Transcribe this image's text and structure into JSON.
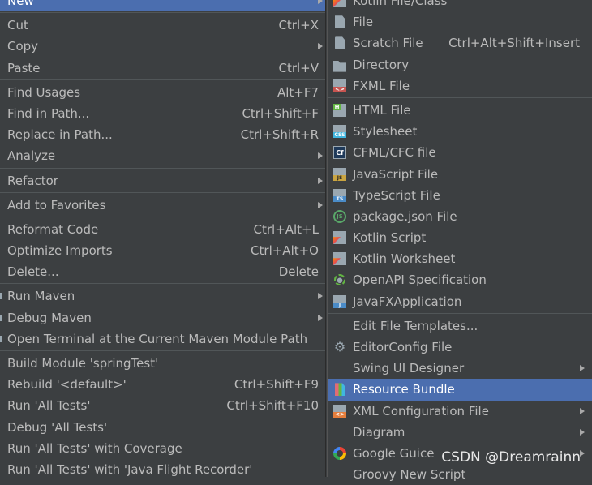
{
  "left_menu": {
    "groups": [
      [
        {
          "label": "New",
          "shortcut": "",
          "submenu": true,
          "selected": true
        }
      ],
      [
        {
          "label": "Cut",
          "shortcut": "Ctrl+X"
        },
        {
          "label": "Copy",
          "shortcut": "",
          "submenu": true
        },
        {
          "label": "Paste",
          "shortcut": "Ctrl+V"
        }
      ],
      [
        {
          "label": "Find Usages",
          "shortcut": "Alt+F7"
        },
        {
          "label": "Find in Path...",
          "shortcut": "Ctrl+Shift+F"
        },
        {
          "label": "Replace in Path...",
          "shortcut": "Ctrl+Shift+R"
        },
        {
          "label": "Analyze",
          "shortcut": "",
          "submenu": true
        }
      ],
      [
        {
          "label": "Refactor",
          "shortcut": "",
          "submenu": true
        }
      ],
      [
        {
          "label": "Add to Favorites",
          "shortcut": "",
          "submenu": true
        }
      ],
      [
        {
          "label": "Reformat Code",
          "shortcut": "Ctrl+Alt+L"
        },
        {
          "label": "Optimize Imports",
          "shortcut": "Ctrl+Alt+O"
        },
        {
          "label": "Delete...",
          "shortcut": "Delete"
        }
      ],
      [
        {
          "label": "Run Maven",
          "shortcut": "",
          "submenu": true,
          "maven": true
        },
        {
          "label": "Debug Maven",
          "shortcut": "",
          "submenu": true,
          "maven": true
        },
        {
          "label": "Open Terminal at the Current Maven Module Path",
          "shortcut": "",
          "maven": true
        }
      ],
      [
        {
          "label": "Build Module 'springTest'",
          "shortcut": ""
        },
        {
          "label": "Rebuild '<default>'",
          "shortcut": "Ctrl+Shift+F9"
        },
        {
          "label": "Run 'All Tests'",
          "shortcut": "Ctrl+Shift+F10"
        },
        {
          "label": "Debug 'All Tests'",
          "shortcut": ""
        },
        {
          "label": "Run 'All Tests' with Coverage",
          "shortcut": ""
        },
        {
          "label": "Run 'All Tests' with 'Java Flight Recorder'",
          "shortcut": ""
        }
      ]
    ]
  },
  "right_menu": {
    "groups": [
      [
        {
          "label": "Kotlin File/Class",
          "icon": "kotlin-file-icon",
          "cls": "ic-kotlin"
        },
        {
          "label": "File",
          "icon": "file-icon",
          "cls": "ic-file"
        },
        {
          "label": "Scratch File",
          "shortcut": "Ctrl+Alt+Shift+Insert",
          "icon": "scratch-file-icon",
          "cls": "ic-scratch"
        },
        {
          "label": "Directory",
          "icon": "folder-icon",
          "cls": "ic-folder"
        },
        {
          "label": "FXML File",
          "icon": "fxml-file-icon",
          "cls": "ic-fxml"
        }
      ],
      [
        {
          "label": "HTML File",
          "icon": "html-file-icon",
          "cls": "ic-html"
        },
        {
          "label": "Stylesheet",
          "icon": "css-file-icon",
          "cls": "ic-css",
          "text": ""
        },
        {
          "label": "CFML/CFC file",
          "icon": "cfml-file-icon",
          "cls": "ic-cf",
          "text": "Cf"
        },
        {
          "label": "JavaScript File",
          "icon": "javascript-file-icon",
          "cls": "ic-js"
        },
        {
          "label": "TypeScript File",
          "icon": "typescript-file-icon",
          "cls": "ic-ts"
        },
        {
          "label": "package.json File",
          "icon": "nodejs-icon",
          "cls": "ic-json",
          "text": "JS"
        },
        {
          "label": "Kotlin Script",
          "icon": "kotlin-script-icon",
          "cls": "ic-kotlin"
        },
        {
          "label": "Kotlin Worksheet",
          "icon": "kotlin-worksheet-icon",
          "cls": "ic-kotlin"
        },
        {
          "label": "OpenAPI Specification",
          "icon": "openapi-icon",
          "cls": "ic-openapi"
        },
        {
          "label": "JavaFXApplication",
          "icon": "javafx-icon",
          "cls": "ic-javafx"
        }
      ],
      [
        {
          "label": "Edit File Templates...",
          "icon": ""
        },
        {
          "label": "EditorConfig File",
          "icon": "gear-icon",
          "cls": "ic-gear",
          "text": "⚙"
        },
        {
          "label": "Swing UI Designer",
          "icon": "",
          "submenu": true
        },
        {
          "label": "Resource Bundle",
          "icon": "resource-bundle-icon",
          "cls": "ic-bundle",
          "selected": true
        },
        {
          "label": "XML Configuration File",
          "icon": "xml-file-icon",
          "cls": "ic-xml",
          "submenu": true
        },
        {
          "label": "Diagram",
          "icon": "",
          "submenu": true
        },
        {
          "label": "Google Guice",
          "icon": "google-icon",
          "cls": "ic-google",
          "submenu": true
        },
        {
          "label": "Groovy New Script",
          "icon": "",
          "submenu": false
        }
      ]
    ]
  },
  "watermark": "CSDN @Dreamrainn"
}
